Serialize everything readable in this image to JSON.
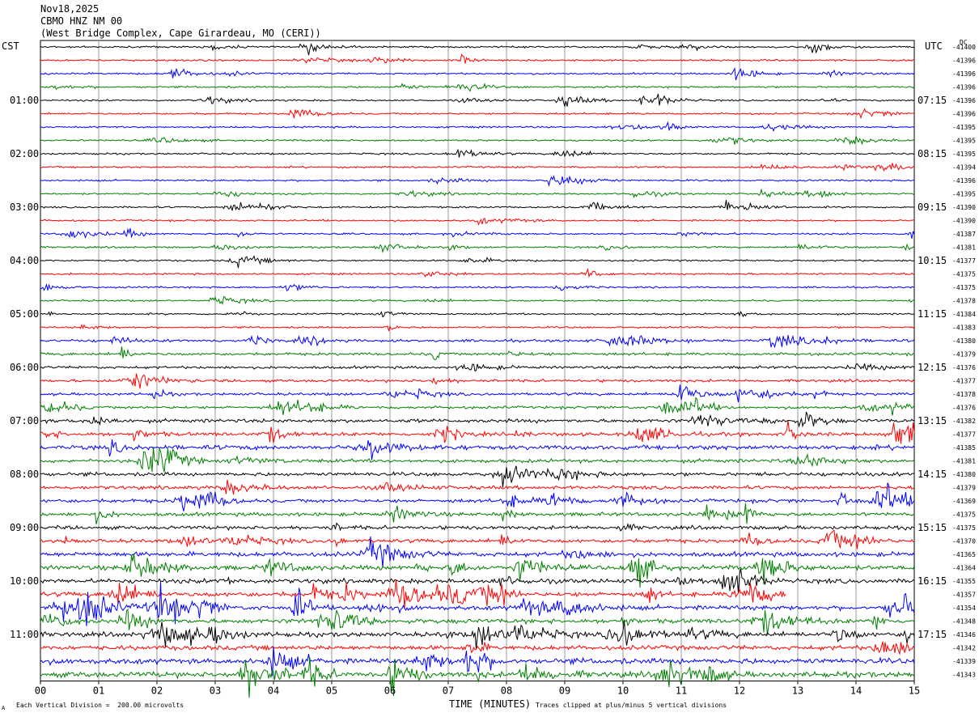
{
  "header": {
    "date": "Nov18,2025",
    "station": "CBMO HNZ NM 00",
    "location": "(West Bridge Complex, Cape Girardeau, MO (CERI))"
  },
  "left_timezone": "CST",
  "right_timezone": "UTC",
  "dc_label": "DC",
  "footer": {
    "scale_text": "Each Vertical Division =  200.00 microvolts",
    "clip_text": "Traces clipped at plus/minus 5 vertical divisions",
    "corner_mark": "A"
  },
  "chart_data": {
    "type": "line",
    "subtype": "helicorder",
    "xlabel": "TIME (MINUTES)",
    "x_ticks": [
      "00",
      "01",
      "02",
      "03",
      "04",
      "05",
      "06",
      "07",
      "08",
      "09",
      "10",
      "11",
      "12",
      "13",
      "14",
      "15"
    ],
    "xlim": [
      0,
      15
    ],
    "grid": true,
    "trace_colors": [
      "#000000",
      "#ff0000",
      "#0000ff",
      "#007f00"
    ],
    "left_hour_labels": [
      "01:00",
      "02:00",
      "03:00",
      "04:00",
      "05:00",
      "06:00",
      "07:00",
      "08:00",
      "09:00",
      "10:00",
      "11:00"
    ],
    "right_hour_labels": [
      "07:15",
      "08:15",
      "09:15",
      "10:15",
      "11:15",
      "12:15",
      "13:15",
      "14:15",
      "15:15",
      "16:15",
      "17:15"
    ],
    "dc_offsets": [
      "-41400",
      "-41396",
      "-41396",
      "-41396",
      "-41396",
      "-41396",
      "-41395",
      "-41395",
      "-41395",
      "-41394",
      "-41396",
      "-41395",
      "-41390",
      "-41390",
      "-41387",
      "-41381",
      "-41377",
      "-41375",
      "-41375",
      "-41378",
      "-41384",
      "-41383",
      "-41380",
      "-41379",
      "-41376",
      "-41377",
      "-41378",
      "-41376",
      "-41382",
      "-41377",
      "-41385",
      "-41381",
      "-41380",
      "-41379",
      "-41369",
      "-41375",
      "-41375",
      "-41370",
      "-41365",
      "-41364",
      "-41355",
      "-41357",
      "-41354",
      "-41348",
      "-41346",
      "-41342",
      "-41339",
      "-41343"
    ],
    "trace_activity": [
      1,
      1,
      1,
      1,
      1,
      1,
      1,
      1,
      1,
      1,
      1,
      1,
      1,
      1,
      1,
      1,
      1,
      1,
      1,
      1,
      1,
      1,
      2,
      2,
      2,
      2,
      2,
      2,
      3,
      3,
      4,
      3,
      3,
      3,
      3,
      3,
      3,
      3,
      4,
      4,
      4,
      4,
      4,
      4,
      4,
      4,
      5,
      5
    ],
    "last_trace_end_minute": 12.8
  }
}
